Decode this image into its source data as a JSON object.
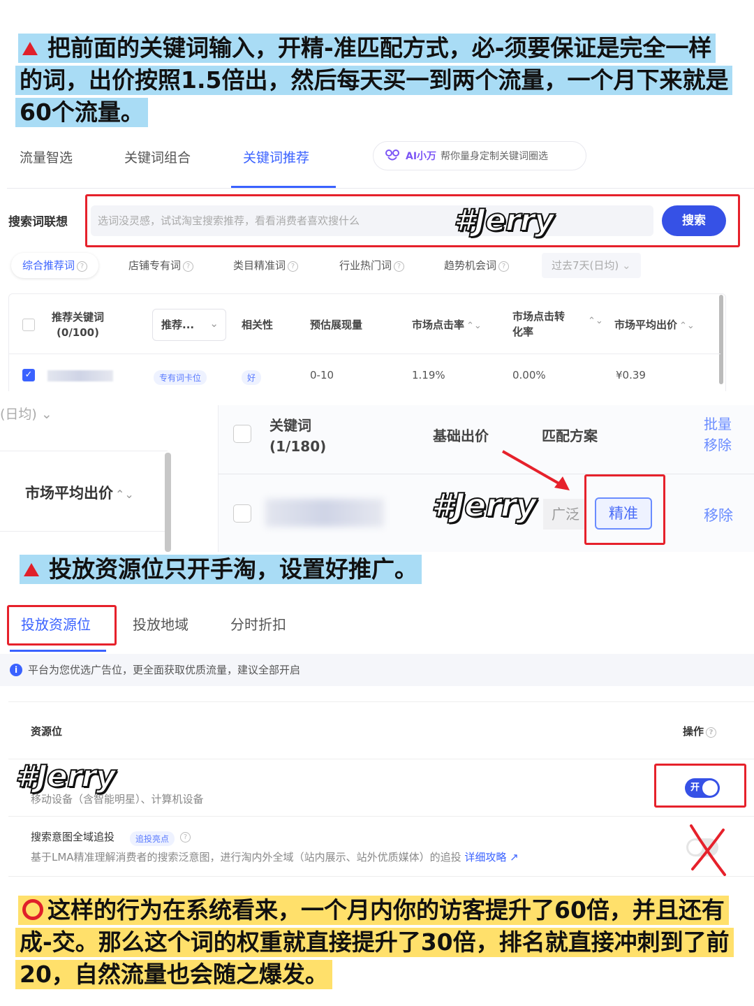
{
  "notes": {
    "top_line1": "把前面的关键词输入，开精-准匹配方式，必-须要保证是完全一样",
    "top_line2": "的词，出价按照1.5倍出，然后每天买一到两个流量，一个月下来就是",
    "top_line3": "60个流量。",
    "middle": "投放资源位只开手淘，设置好推广。",
    "bottom_line1": "这样的行为在系统看来，一个月内你的访客提升了60倍，并且还有",
    "bottom_line2": "成-交。那么这个词的权重就直接提升了30倍，排名就直接冲刺到了前",
    "bottom_line3": "20，自然流量也会随之爆发。"
  },
  "watermark": "#Jerry",
  "tabs": [
    "流量智选",
    "关键词组合",
    "关键词推荐"
  ],
  "ai_pill": {
    "label": "AI小万",
    "desc": "帮你量身定制关键词圈选"
  },
  "search": {
    "label": "搜索词联想",
    "placeholder": "选词没灵感，试试淘宝搜索推荐，看看消费者喜欢搜什么",
    "button": "搜索"
  },
  "filters": [
    "综合推荐词",
    "店铺专有词",
    "类目精准词",
    "行业热门词",
    "趋势机会词",
    "过去7天(日均)"
  ],
  "rec_table": {
    "headers": {
      "keyword_l1": "推荐关键词",
      "keyword_l2": "(0/100)",
      "rec_dropdown": "推荐...",
      "relevance": "相关性",
      "impressions": "预估展现量",
      "ctr": "市场点击率",
      "cvr_l1": "市场点击转",
      "cvr_l2": "化率",
      "avg_bid": "市场平均出价"
    },
    "row": {
      "tag": "专有词卡位",
      "relevance": "好",
      "impressions": "0-10",
      "ctr": "1.19%",
      "cvr": "0.00%",
      "avg_bid": "¥0.39"
    }
  },
  "left_fragment": {
    "date_label": "(日均)",
    "avg_bid": "市场平均出价"
  },
  "selected_table": {
    "headers": {
      "keyword_l1": "关键词",
      "keyword_l2": "(1/180)",
      "base_bid": "基础出价",
      "match": "匹配方案",
      "batch_l1": "批量",
      "batch_l2": "移除"
    },
    "row": {
      "broad": "广泛",
      "exact": "精准",
      "remove": "移除"
    }
  },
  "settings_tabs": [
    "投放资源位",
    "投放地域",
    "分时折扣"
  ],
  "info_bar": "平台为您优选广告位，更全面获取优质流量，建议全部开启",
  "resource_table": {
    "col_resource": "资源位",
    "col_action": "操作",
    "row1_sub": "移动设备（含智能明星）、计算机设备",
    "toggle_on": "开",
    "row2_title": "搜索意图全域追投",
    "row2_badge": "追投亮点",
    "row2_desc": "基于LMA精准理解消费者的搜索泛意图，进行淘内外全域（站内展示、站外优质媒体）的追投",
    "row2_link": "详细攻略"
  },
  "colors": {
    "accent_blue": "#3651e6",
    "note_blue": "#a9dcf5",
    "note_yellow": "#ffe06b",
    "red": "#e6212b"
  }
}
